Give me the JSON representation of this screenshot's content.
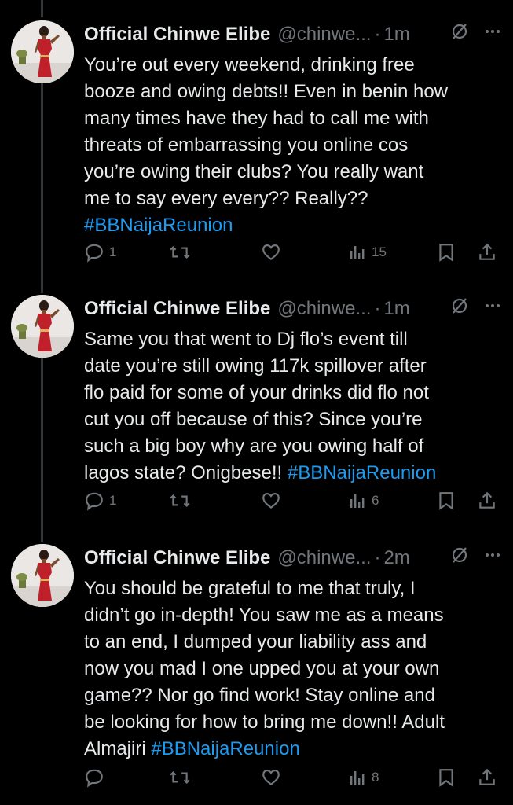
{
  "tweets": [
    {
      "name": "Official Chinwe Elibe",
      "handle": "@chinwe...",
      "separator": "·",
      "time": "1m",
      "body_lines": [
        "You’re out every weekend, drinking free",
        "booze and owing debts!! Even in benin how",
        "many times have they had to call me with",
        "threats of embarrassing you online cos",
        "you’re owing their clubs? You really want",
        "me to say every every?? Really??"
      ],
      "hashtag": "#BBNaijaReunion",
      "hashtag_prefix": "",
      "replies": "1",
      "retweets": "",
      "likes": "",
      "views": "15"
    },
    {
      "name": "Official Chinwe Elibe",
      "handle": "@chinwe...",
      "separator": "·",
      "time": "1m",
      "body_lines": [
        "Same you that went to Dj flo’s event till",
        "date you’re still owing 117k spillover after",
        "flo paid for some of your drinks did flo not",
        "cut you off because of this? Since you’re",
        "such a big boy why are you owing half of"
      ],
      "hashtag": "#BBNaijaReunion",
      "hashtag_prefix": "lagos state? Onigbese!! ",
      "replies": "1",
      "retweets": "",
      "likes": "",
      "views": "6"
    },
    {
      "name": "Official Chinwe Elibe",
      "handle": "@chinwe...",
      "separator": "·",
      "time": "2m",
      "body_lines": [
        "You should be grateful to me that truly, I",
        "didn’t go in-depth! You saw me as a means",
        "to an end, I dumped your liability ass and",
        "now you mad I one upped you at your own",
        "game?? Nor go find work! Stay online and",
        "be looking for how to bring me down!! Adult"
      ],
      "hashtag": "#BBNaijaReunion",
      "hashtag_prefix": "Almajiri ",
      "replies": "",
      "retweets": "",
      "likes": "",
      "views": "8"
    }
  ],
  "colors": {
    "background": "#000000",
    "text": "#e7e9ea",
    "muted": "#71767b",
    "link": "#1d9bf0",
    "thread_line": "#333639"
  },
  "icons": [
    "grok-slash-icon",
    "more-icon",
    "reply-icon",
    "retweet-icon",
    "like-icon",
    "views-icon",
    "bookmark-icon",
    "share-icon"
  ]
}
